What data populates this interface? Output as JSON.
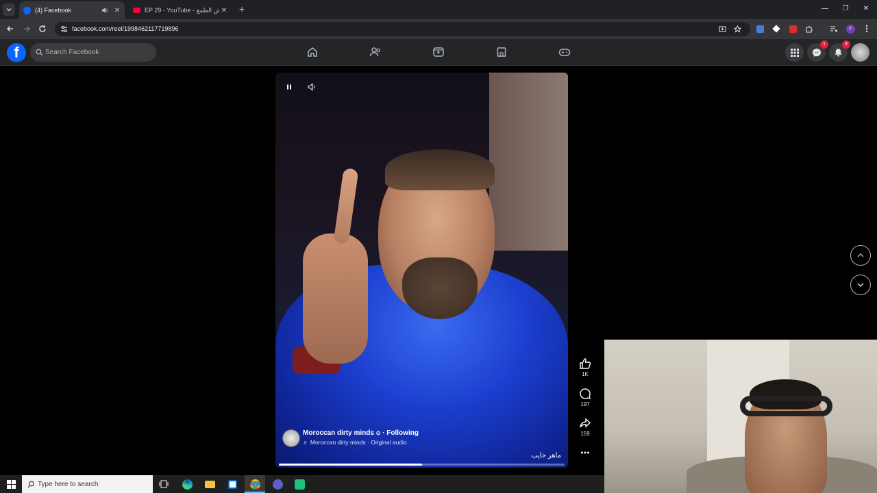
{
  "browser": {
    "tabs": [
      {
        "title": "(4) Facebook",
        "active": true
      },
      {
        "title": "EP 29 - YouTube - عش الطمع",
        "active": false
      }
    ],
    "url": "facebook.com/reel/1998462117719896"
  },
  "facebook": {
    "search_placeholder": "Search Facebook",
    "messenger_badge": "1",
    "notifications_badge": "3"
  },
  "reel": {
    "author": "Moroccan dirty minds",
    "following_label": "· Following",
    "audio": "Moroccan dirty minds · Original audio",
    "caption": "ماهر خايب",
    "progress_percent": 50,
    "likes": "1K",
    "comments": "197",
    "shares": "159"
  },
  "taskbar": {
    "search_placeholder": "Type here to search"
  },
  "colors": {
    "fb_blue": "#0866ff",
    "badge_red": "#e41e3f"
  }
}
